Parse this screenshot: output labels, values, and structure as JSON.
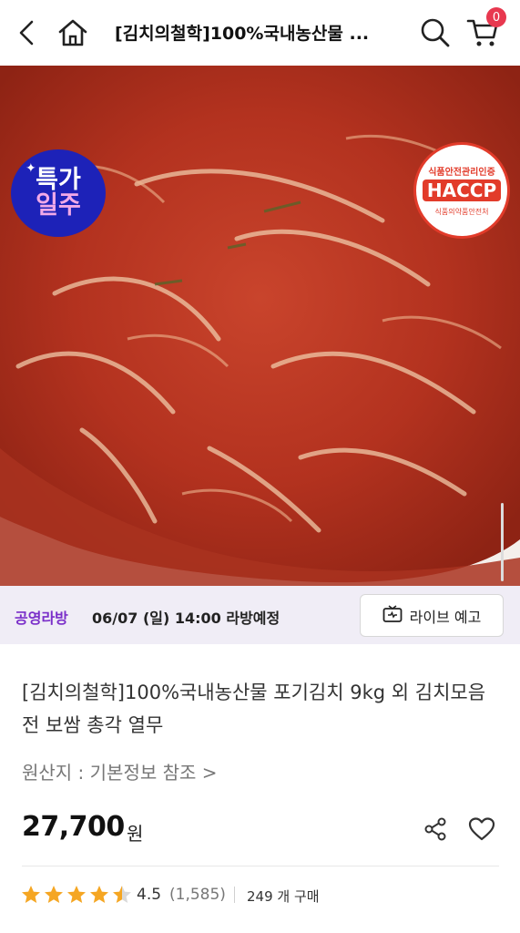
{
  "header": {
    "title": "[김치의철학]100%국내농산물 ...",
    "cart_count": "0"
  },
  "hero": {
    "badge_line1": "특가",
    "badge_line2": "일주",
    "haccp_top": "식품안전관리인증",
    "haccp_mid": "HACCP",
    "haccp_bottom": "식품의약품안전처"
  },
  "live": {
    "host": "공영라방",
    "schedule": "06/07 (일) 14:00 라방예정",
    "button_label": "라이브 예고"
  },
  "product": {
    "title": "[김치의철학]100%국내농산물 포기김치 9kg 외 김치모음전 보쌈 총각 열무",
    "origin": "원산지 : 기본정보 참조 >",
    "price": "27,700",
    "currency": "원",
    "rating": "4.5",
    "rating_value": 4.5,
    "review_count": "(1,585)",
    "purchases": "249 개 구매"
  },
  "colors": {
    "accent_purple": "#7a2ec9",
    "star": "#f5a623",
    "badge_red": "#e8384f"
  }
}
